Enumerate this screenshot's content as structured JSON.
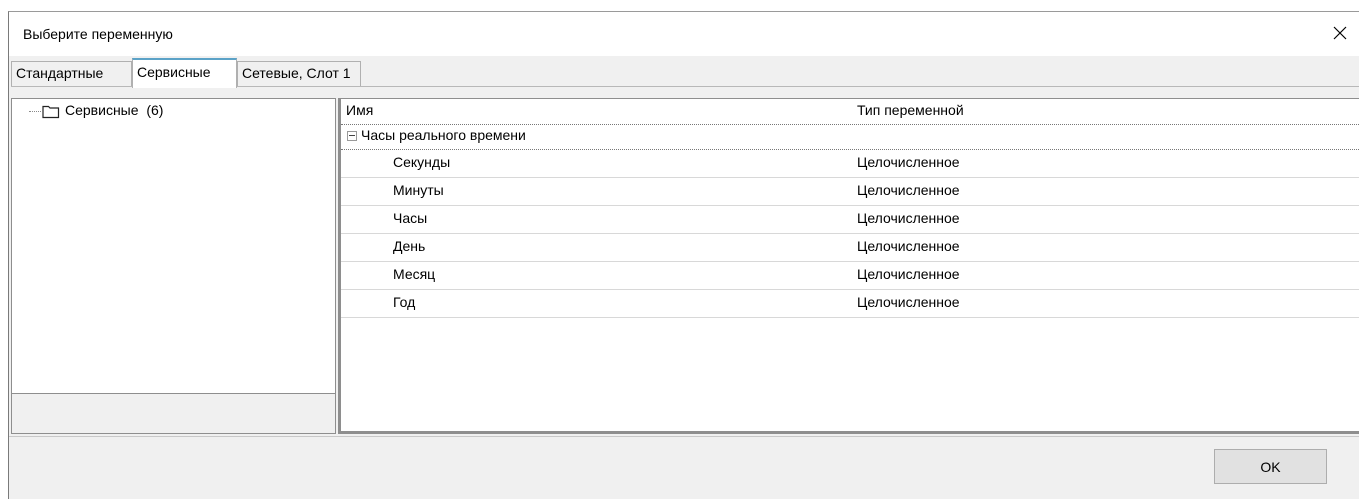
{
  "window": {
    "title": "Выберите переменную",
    "close_icon": "close-icon"
  },
  "tabs": [
    {
      "label": "Стандартные",
      "active": false
    },
    {
      "label": "Сервисные",
      "active": true
    },
    {
      "label": "Сетевые, Слот 1",
      "active": false
    }
  ],
  "tree": {
    "root": {
      "label": "Сервисные",
      "count": "(6)",
      "icon": "folder-icon"
    }
  },
  "table": {
    "columns": {
      "name": "Имя",
      "type": "Тип переменной"
    },
    "group": {
      "label": "Часы реального времени",
      "expanded": true
    },
    "rows": [
      {
        "name": "Секунды",
        "type": "Целочисленное"
      },
      {
        "name": "Минуты",
        "type": "Целочисленное"
      },
      {
        "name": "Часы",
        "type": "Целочисленное"
      },
      {
        "name": "День",
        "type": "Целочисленное"
      },
      {
        "name": "Месяц",
        "type": "Целочисленное"
      },
      {
        "name": "Год",
        "type": "Целочисленное"
      }
    ]
  },
  "buttons": {
    "ok_label": "OK"
  },
  "colors": {
    "active_tab_accent": "#5ba2c7",
    "dialog_background": "#f0f0f0"
  }
}
